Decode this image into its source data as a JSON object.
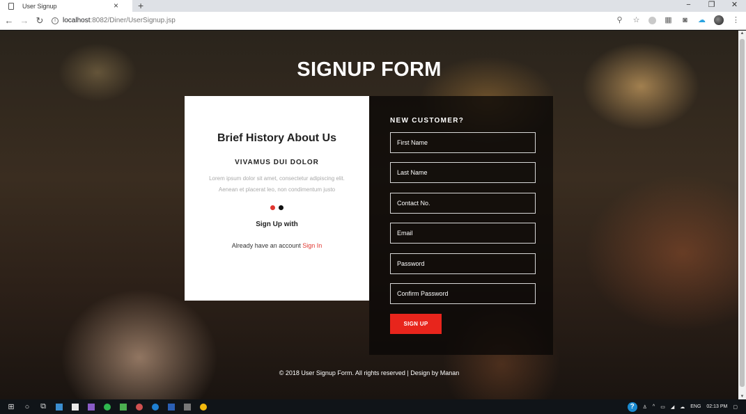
{
  "browser": {
    "tab_title": "User Signup",
    "tab_close": "×",
    "new_tab": "+",
    "url_host": "localhost",
    "url_path": ":8082/Diner/UserSignup.jsp"
  },
  "page": {
    "title": "SIGNUP FORM",
    "left": {
      "heading": "Brief History About Us",
      "subheading": "VIVAMUS DUI DOLOR",
      "body": "Lorem ipsum dolor sit amet, consectetur adipiscing elit. Aenean et placerat leo, non condimentum justo",
      "signup_with": "Sign Up with",
      "already_text": "Already have an account ",
      "signin_link": "Sign In",
      "dot_colors": [
        "#e0362f",
        "#111111"
      ]
    },
    "right": {
      "heading": "NEW CUSTOMER?",
      "fields": {
        "first_name": "First Name",
        "last_name": "Last Name",
        "contact": "Contact No.",
        "email": "Email",
        "password": "Password",
        "confirm_password": "Confirm Password"
      },
      "submit_label": "SIGN UP"
    },
    "footer": "© 2018 User Signup Form. All rights reserved | Design by Manan"
  },
  "taskbar": {
    "lang": "ENG",
    "time": "02:13 PM"
  },
  "colors": {
    "accent": "#e8251c",
    "link": "#e0362f"
  }
}
